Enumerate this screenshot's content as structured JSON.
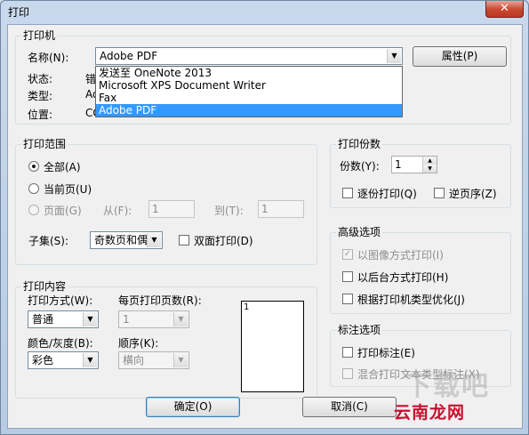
{
  "window": {
    "title": "打印",
    "close_glyph": "✕"
  },
  "printer": {
    "group": "打印机",
    "name_label": "名称(N):",
    "name_value": "Adobe PDF",
    "properties_button": "属性(P)",
    "status_label": "状态:",
    "status_value": "错",
    "type_label": "类型:",
    "type_value": "Ad",
    "location_label": "位置:",
    "location_value": "CO",
    "dropdown_options": [
      "发送至 OneNote 2013",
      "Microsoft XPS Document Writer",
      "Fax",
      "Adobe PDF"
    ],
    "selected_index": 3
  },
  "range": {
    "group": "打印范围",
    "all": "全部(A)",
    "current": "当前页(U)",
    "pages": "页面(G)",
    "from_label": "从(F):",
    "from_value": "1",
    "to_label": "到(T):",
    "to_value": "1",
    "subset_label": "子集(S):",
    "subset_value": "奇数页和偶",
    "duplex": "双面打印(D)"
  },
  "copies": {
    "group": "打印份数",
    "count_label": "份数(Y):",
    "count_value": "1",
    "collate": "逐份打印(Q)",
    "reverse": "逆页序(Z)"
  },
  "advanced": {
    "group": "高级选项",
    "as_image": "以图像方式打印(I)",
    "background": "以后台方式打印(H)",
    "optimize": "根据打印机类型优化(J)"
  },
  "content": {
    "group": "打印内容",
    "mode_label": "打印方式(W):",
    "mode_value": "普通",
    "pages_per_sheet_label": "每页打印页数(R):",
    "pages_per_sheet_value": "1",
    "color_label": "颜色/灰度(B):",
    "color_value": "彩色",
    "order_label": "顺序(K):",
    "order_value": "横向",
    "preview_text": "1"
  },
  "annotation": {
    "group": "标注选项",
    "print_annot": "打印标注(E)",
    "mix_annot": "混合打印文本类型标注(X)"
  },
  "buttons": {
    "ok": "确定(O)",
    "cancel": "取消(C)"
  },
  "watermark": {
    "big": "下载吧",
    "brand": "云南龙网"
  }
}
